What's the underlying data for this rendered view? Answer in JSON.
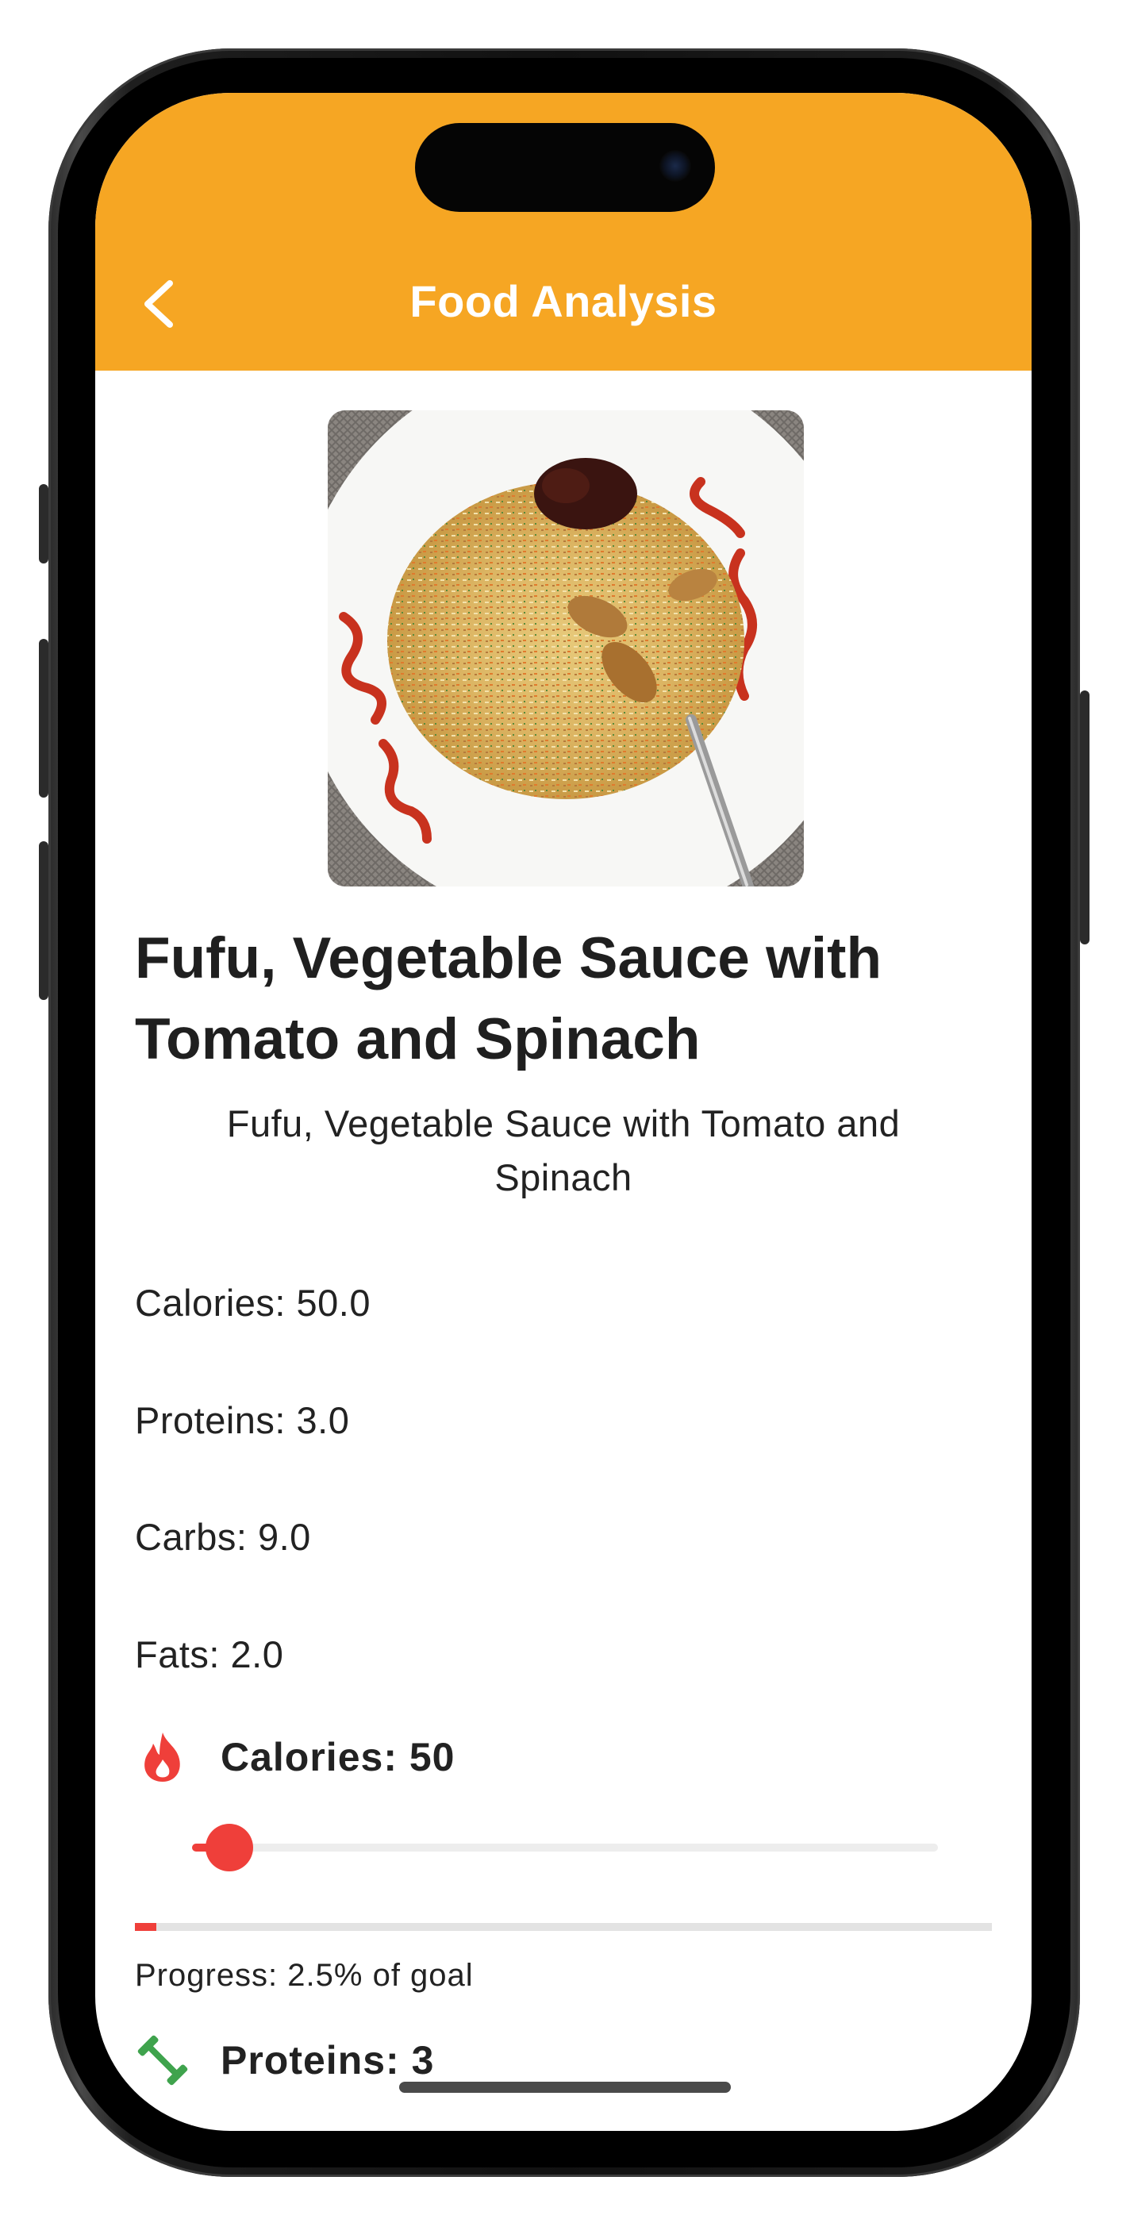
{
  "header": {
    "title": "Food Analysis",
    "background": "#f6a623",
    "back_icon": "chevron-left-icon"
  },
  "food": {
    "title": "Fufu, Vegetable Sauce with Tomato and Spinach",
    "subtitle": "Fufu, Vegetable Sauce with Tomato and Spinach"
  },
  "stats": [
    {
      "label": "Calories: 50.0"
    },
    {
      "label": "Proteins: 3.0"
    },
    {
      "label": "Carbs: 9.0"
    },
    {
      "label": "Fats: 2.0"
    }
  ],
  "metrics": {
    "calories": {
      "label": "Calories: 50",
      "icon": "flame-icon",
      "slider_fraction": 0.05,
      "progress_percent": 2.5,
      "progress_text": "Progress: 2.5% of goal",
      "color": "#ef3f3a"
    },
    "proteins": {
      "label": "Proteins: 3",
      "icon": "dumbbell-icon",
      "color": "#3fa34d"
    }
  }
}
